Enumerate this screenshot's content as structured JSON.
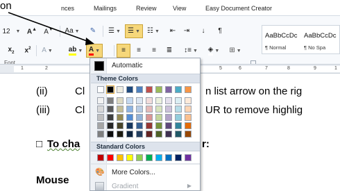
{
  "callout": {
    "text": "on"
  },
  "ribbon": {
    "tabs": [
      "nces",
      "Mailings",
      "Review",
      "View",
      "Easy Document Creator"
    ],
    "font_size": "12",
    "font_group_label": "Font",
    "styles": [
      {
        "sample": "AaBbCcDc",
        "name": "¶ Normal"
      },
      {
        "sample": "AaBbCcDc",
        "name": "¶ No Spa"
      }
    ]
  },
  "ruler": {
    "numbers": [
      "1",
      "2",
      "5",
      "6",
      "7",
      "8",
      "9",
      "1"
    ]
  },
  "document": {
    "line_ii_num": "(ii)",
    "line_ii_a": "Cl",
    "line_ii_b": "n list arrow on the rig",
    "line_iii_num": "(iii)",
    "line_iii_a": "Cl",
    "line_iii_b": "UR to remove highlig",
    "heading_bullet": "□",
    "heading_a": "To cha",
    "heading_b": "r:",
    "mouse": "Mouse"
  },
  "color_menu": {
    "automatic": "Automatic",
    "theme_heading": "Theme Colors",
    "theme_top_row": [
      "#ffffff",
      "#000000",
      "#eeece1",
      "#1f497d",
      "#4f81bd",
      "#c0504d",
      "#9bbb59",
      "#8064a2",
      "#4bacc6",
      "#f79646"
    ],
    "theme_shades": [
      [
        "#f2f2f2",
        "#7f7f7f",
        "#ddd9c3",
        "#c6d9f0",
        "#dbe5f1",
        "#f2dcdb",
        "#ebf1dd",
        "#e5e0ec",
        "#dbeef3",
        "#fdeada"
      ],
      [
        "#d8d8d8",
        "#595959",
        "#c4bd97",
        "#8db3e2",
        "#b8cce4",
        "#e5b9b7",
        "#d7e3bc",
        "#ccc1d9",
        "#b7dde8",
        "#fbd5b5"
      ],
      [
        "#bfbfbf",
        "#3f3f3f",
        "#938953",
        "#548dd4",
        "#95b3d7",
        "#d99694",
        "#c3d69b",
        "#b2a2c7",
        "#92cddc",
        "#fac08f"
      ],
      [
        "#a5a5a5",
        "#262626",
        "#494429",
        "#17365d",
        "#366092",
        "#953734",
        "#76923c",
        "#5f497a",
        "#31859b",
        "#e36c09"
      ],
      [
        "#7f7f7f",
        "#0c0c0c",
        "#1d1b10",
        "#0f243e",
        "#244061",
        "#632423",
        "#4f6128",
        "#3f3151",
        "#205867",
        "#974806"
      ]
    ],
    "standard_heading": "Standard Colors",
    "standard": [
      "#c00000",
      "#ff0000",
      "#ffc000",
      "#ffff00",
      "#92d050",
      "#00b050",
      "#00b0f0",
      "#0070c0",
      "#002060",
      "#7030a0"
    ],
    "more_colors": "More Colors...",
    "gradient": "Gradient"
  }
}
